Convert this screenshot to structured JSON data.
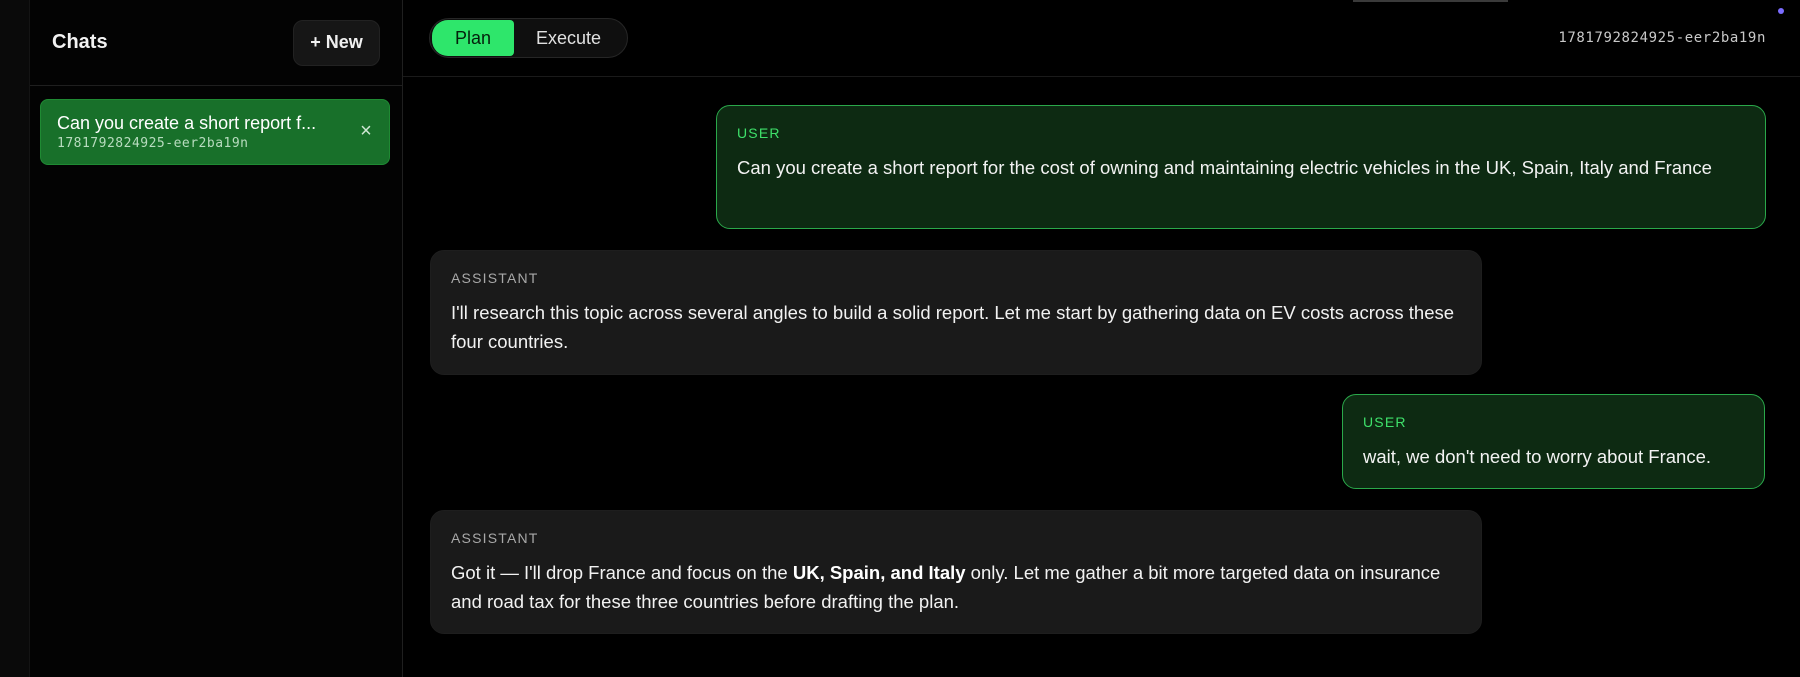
{
  "sidebar": {
    "title": "Chats",
    "new_button_label": "+ New",
    "chats": [
      {
        "title": "Can you create a short report f...",
        "id": "1781792824925-eer2ba19n",
        "close_glyph": "×"
      }
    ]
  },
  "topbar": {
    "modes": [
      {
        "label": "Plan",
        "active": true
      },
      {
        "label": "Execute",
        "active": false
      }
    ],
    "session_id": "1781792824925-eer2ba19n"
  },
  "messages": [
    {
      "role": "USER",
      "text": "Can you create a short report for the cost of owning and maintaining electric vehicles in the UK, Spain, Italy and France"
    },
    {
      "role": "ASSISTANT",
      "text": "I'll research this topic across several angles to build a solid report. Let me start by gathering data on EV costs across these four countries."
    },
    {
      "role": "USER",
      "text": "wait, we don't need to worry about France."
    },
    {
      "role": "ASSISTANT",
      "text_before": "Got it — I'll drop France and focus on the ",
      "text_bold": "UK, Spain, and Italy",
      "text_after": " only. Let me gather a bit more targeted data on insurance and road tax for these three countries before drafting the plan."
    }
  ],
  "colors": {
    "accent_green": "#2ee66b",
    "user_bubble_bg": "#0d2a12",
    "user_bubble_border": "#2aa84a",
    "assistant_bubble_bg": "#1a1a1a",
    "selected_chat_bg": "#18702a",
    "background": "#000000"
  },
  "icons": {
    "close": "close-icon",
    "indicator": "status-dot"
  }
}
